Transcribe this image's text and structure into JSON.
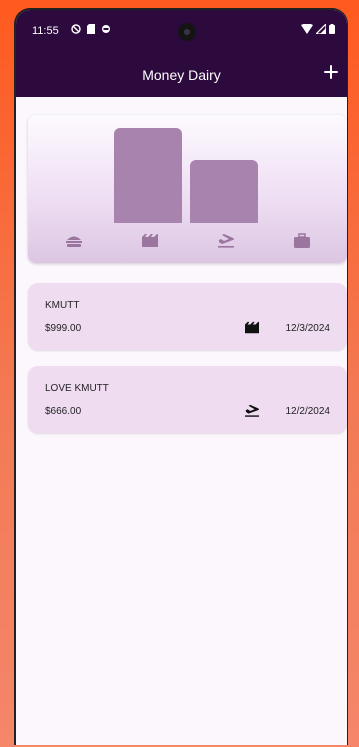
{
  "status": {
    "time": "11:55"
  },
  "appbar": {
    "title": "Money Dairy",
    "add_icon": "plus-icon"
  },
  "chart_data": {
    "type": "bar",
    "categories": [
      "food",
      "entertainment",
      "travel",
      "work"
    ],
    "category_icons": [
      "burger-icon",
      "movie-icon",
      "flight-icon",
      "briefcase-icon"
    ],
    "values": [
      0,
      999,
      666,
      0
    ],
    "bar_color": "#a883ae"
  },
  "transactions": [
    {
      "name": "KMUTT",
      "amount": "$999.00",
      "date": "12/3/2024",
      "icon": "movie-icon"
    },
    {
      "name": "LOVE KMUTT",
      "amount": "$666.00",
      "date": "12/2/2024",
      "icon": "flight-icon"
    }
  ],
  "colors": {
    "primary": "#2c0a3d",
    "background": "#fcf6fd",
    "card": "#f0dcf1"
  }
}
